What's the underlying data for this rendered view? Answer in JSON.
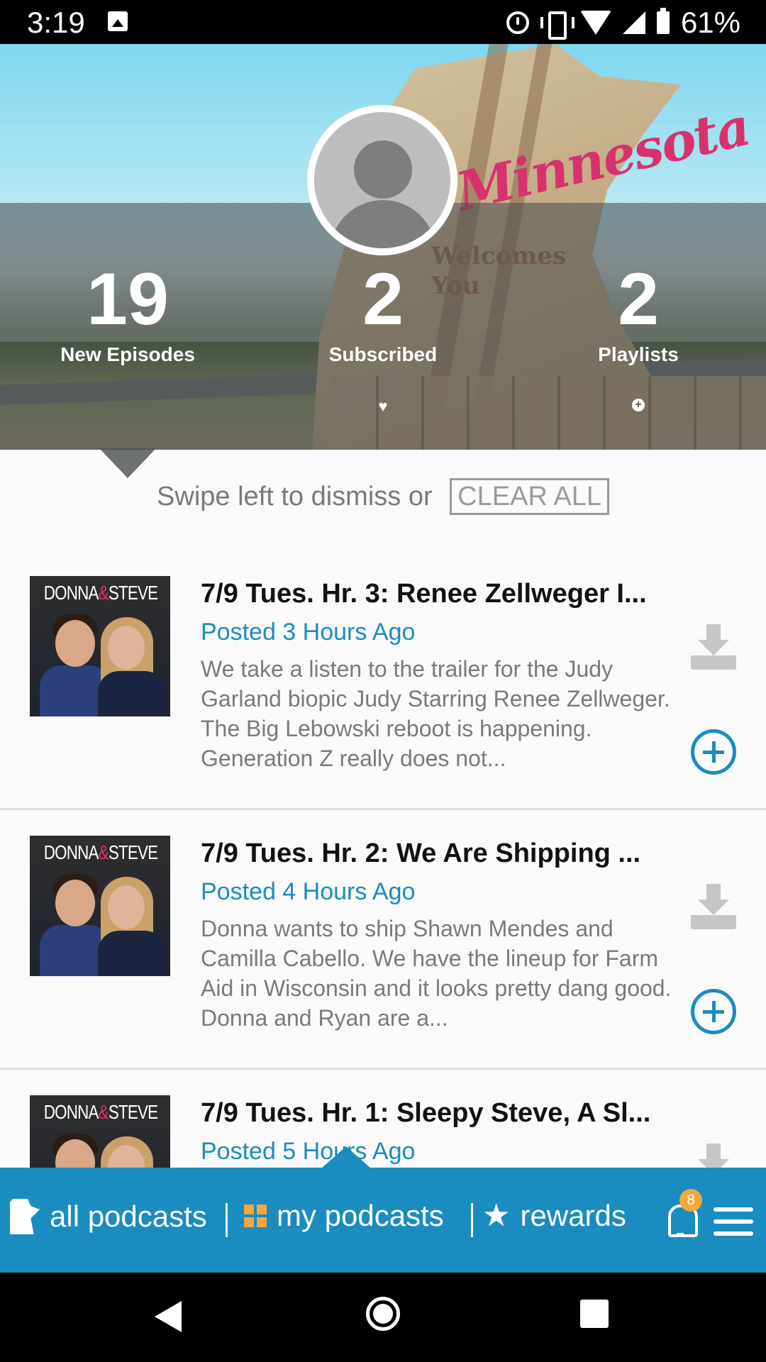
{
  "status_bar": {
    "time": "3:19",
    "battery": "61%",
    "icons": [
      "image-icon",
      "alarm-icon",
      "vibrate-icon",
      "wifi-icon",
      "signal-icon",
      "battery-icon"
    ]
  },
  "header": {
    "banner_sign_text": "Minnesota",
    "banner_sign_welcome": "Welcomes\nYou",
    "stats": [
      {
        "value": "19",
        "label": "New Episodes"
      },
      {
        "value": "2",
        "label": "Subscribed",
        "icon": "heart-icon"
      },
      {
        "value": "2",
        "label": "Playlists",
        "icon": "plus-icon"
      }
    ]
  },
  "swipe": {
    "text": "Swipe left to dismiss or",
    "clear_all_label": "CLEAR ALL"
  },
  "episodes": [
    {
      "thumb_title_left": "DONNA",
      "thumb_title_amp": "&",
      "thumb_title_right": "STEVE",
      "title": "7/9 Tues. Hr. 3: Renee Zellweger I...",
      "posted": "Posted 3 Hours Ago",
      "description": "We take a listen to the trailer for the Judy Garland biopic Judy Starring Renee Zellweger. The Big Lebowski reboot is happening. Generation Z really does not..."
    },
    {
      "thumb_title_left": "DONNA",
      "thumb_title_amp": "&",
      "thumb_title_right": "STEVE",
      "title": "7/9 Tues. Hr. 2: We Are Shipping ...",
      "posted": "Posted 4 Hours Ago",
      "description": "Donna wants to ship Shawn Mendes and Camilla Cabello. We have the lineup for Farm Aid in Wisconsin and it looks pretty dang good. Donna and Ryan are a..."
    },
    {
      "thumb_title_left": "DONNA",
      "thumb_title_amp": "&",
      "thumb_title_right": "STEVE",
      "title": "7/9 Tues. Hr. 1: Sleepy Steve, A Sl...",
      "posted": "Posted 5 Hours Ago",
      "description": ""
    }
  ],
  "bottom_nav": {
    "all_podcasts": "all podcasts",
    "my_podcasts": "my podcasts",
    "rewards": "rewards",
    "notification_count": "8"
  },
  "colors": {
    "accent": "#1a8cc0",
    "badge": "#f4a83a",
    "sign_script": "#d8326e"
  }
}
